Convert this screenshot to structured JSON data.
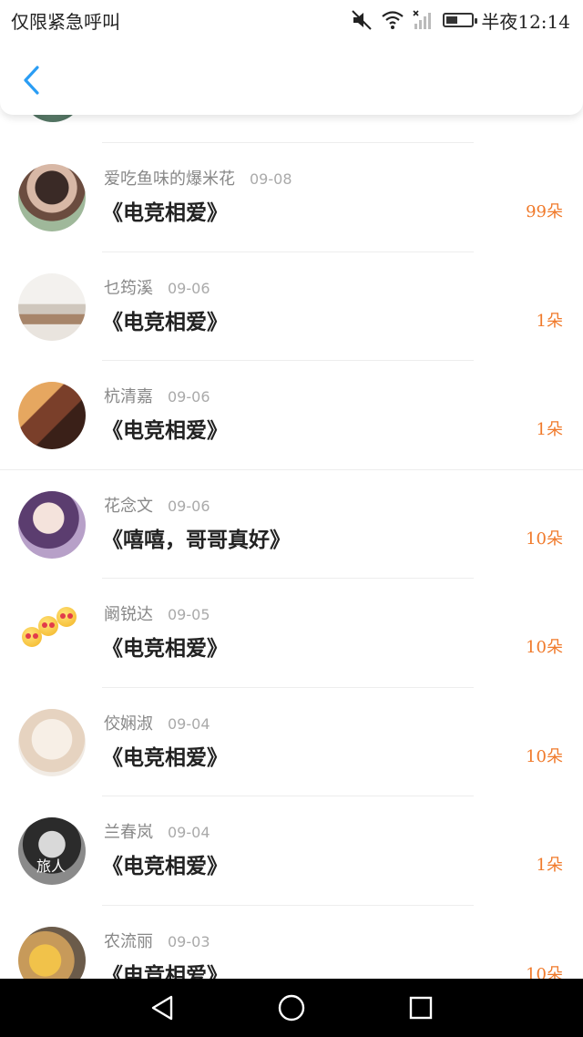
{
  "status_bar": {
    "left_text": "仅限紧急呼叫",
    "time": "半夜12:14",
    "battery_level": 0.45,
    "icons": [
      "mute-icon",
      "wifi-icon",
      "signal-icon",
      "battery-icon"
    ]
  },
  "header": {
    "back_icon": "chevron-left-icon",
    "accent_color": "#2a9df4"
  },
  "list": {
    "amount_color": "#f07a2b",
    "items": [
      {
        "name": "爱吃鱼味的爆米花",
        "date": "09-08",
        "title": "《电竞相爱》",
        "amount": "99朵"
      },
      {
        "name": "乜筠溪",
        "date": "09-06",
        "title": "《电竞相爱》",
        "amount": "1朵"
      },
      {
        "name": "杭清嘉",
        "date": "09-06",
        "title": "《电竞相爱》",
        "amount": "1朵"
      },
      {
        "name": "花念文",
        "date": "09-06",
        "title": "《嘻嘻，哥哥真好》",
        "amount": "10朵"
      },
      {
        "name": "阚锐达",
        "date": "09-05",
        "title": "《电竞相爱》",
        "amount": "10朵"
      },
      {
        "name": "佼娴淑",
        "date": "09-04",
        "title": "《电竞相爱》",
        "amount": "10朵"
      },
      {
        "name": "兰春岚",
        "date": "09-04",
        "title": "《电竞相爱》",
        "amount": "1朵"
      },
      {
        "name": "农流丽",
        "date": "09-03",
        "title": "《电竞相爱》",
        "amount": "10朵"
      }
    ]
  },
  "avatar_text": "旅人",
  "nav_bar": {
    "icons": [
      "back-triangle-icon",
      "home-circle-icon",
      "recents-square-icon"
    ]
  }
}
